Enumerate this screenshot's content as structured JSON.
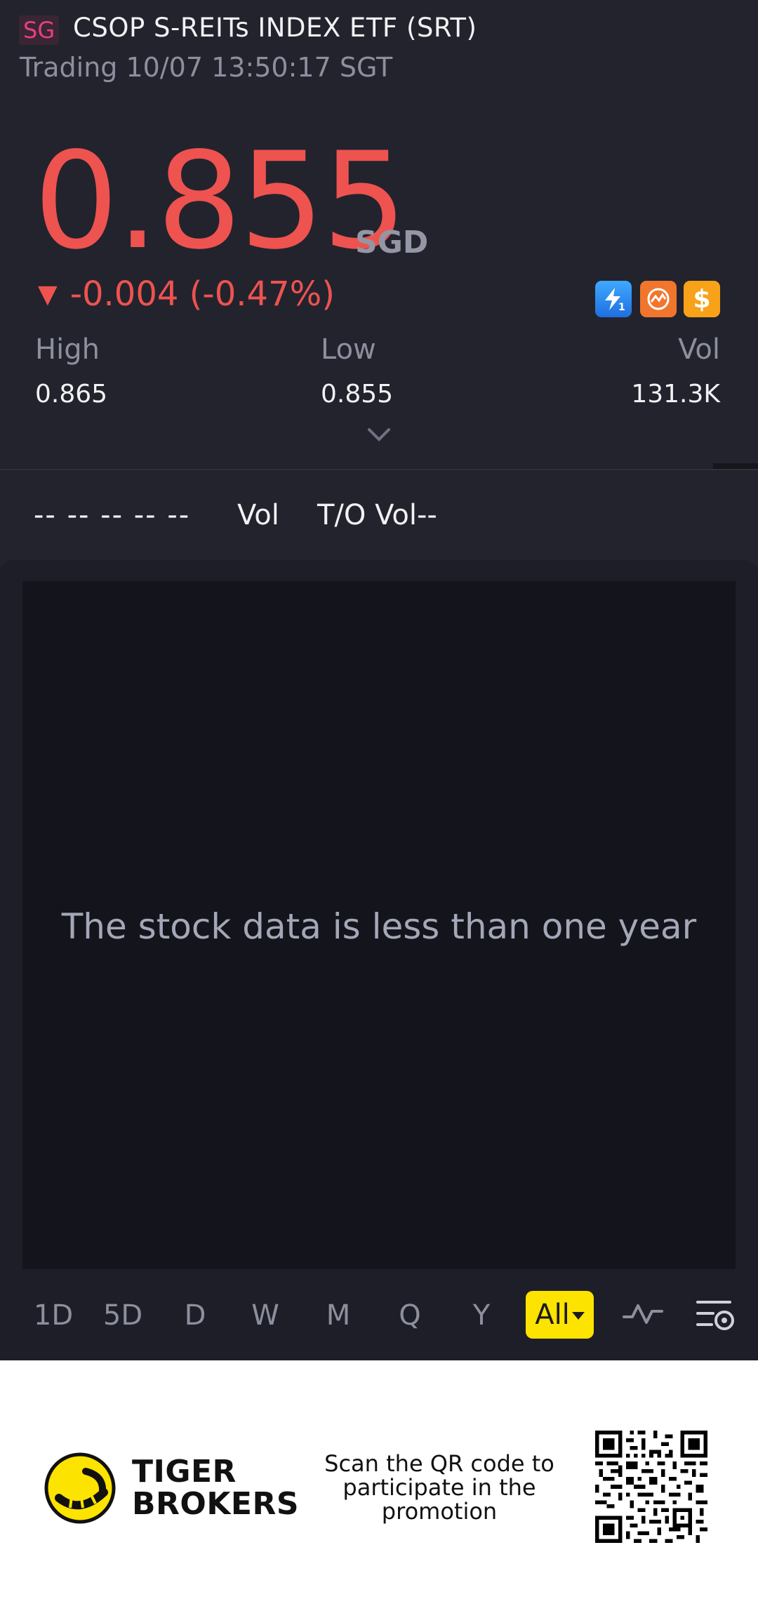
{
  "header": {
    "market": "SG",
    "name": "CSOP S-REITs INDEX ETF (SRT)",
    "status": "Trading 10/07 13:50:17 SGT"
  },
  "quote": {
    "price": "0.855",
    "currency": "SGD",
    "change": "-0.004 (-0.47%)",
    "change_direction": "down",
    "color_down": "#ee5350",
    "badges": [
      "lightning-level-1-icon",
      "chart-badge-icon",
      "dollar-icon"
    ]
  },
  "stats": {
    "high_label": "High",
    "high_value": "0.865",
    "low_label": "Low",
    "low_value": "0.855",
    "vol_label": "Vol",
    "vol_value": "131.3K"
  },
  "indicator_strip": {
    "placeholder": "-- -- -- -- --",
    "vol_label": "Vol",
    "tovol_label": "T/O Vol--"
  },
  "chart": {
    "empty_message": "The stock data is less than one year"
  },
  "periods": {
    "tabs": [
      "1D",
      "5D",
      "D",
      "W",
      "M",
      "Q",
      "Y"
    ],
    "active": "All",
    "accent": "#fde300"
  },
  "footer": {
    "brand_line1": "TIGER",
    "brand_line2": "BROKERS",
    "promo": "Scan the QR code to participate in the promotion"
  }
}
